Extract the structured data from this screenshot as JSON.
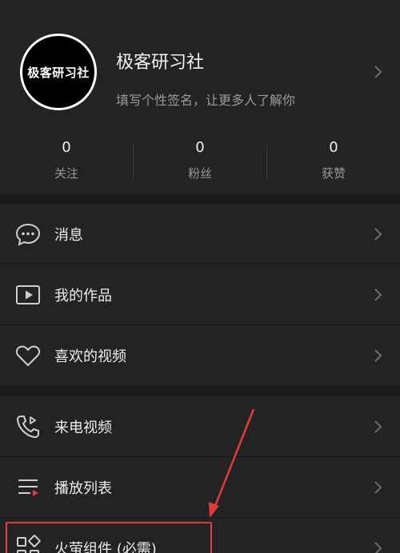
{
  "profile": {
    "avatar_text": "极客研习社",
    "username": "极客研习社",
    "signature": "填写个性签名，让更多人了解你",
    "stats": [
      {
        "value": "0",
        "label": "关注"
      },
      {
        "value": "0",
        "label": "粉丝"
      },
      {
        "value": "0",
        "label": "获赞"
      }
    ]
  },
  "menu_group_1": [
    {
      "label": "消息",
      "icon": "message-bubble-icon"
    },
    {
      "label": "我的作品",
      "icon": "play-video-icon"
    },
    {
      "label": "喜欢的视频",
      "icon": "heart-icon"
    }
  ],
  "menu_group_2": [
    {
      "label": "来电视频",
      "icon": "phone-video-icon"
    },
    {
      "label": "播放列表",
      "icon": "playlist-icon"
    },
    {
      "label": "火萤组件 (必需)",
      "icon": "widgets-icon"
    }
  ],
  "colors": {
    "background": "#1a1a1a",
    "panel": "#232323",
    "annotation_red": "#e23b3b"
  }
}
